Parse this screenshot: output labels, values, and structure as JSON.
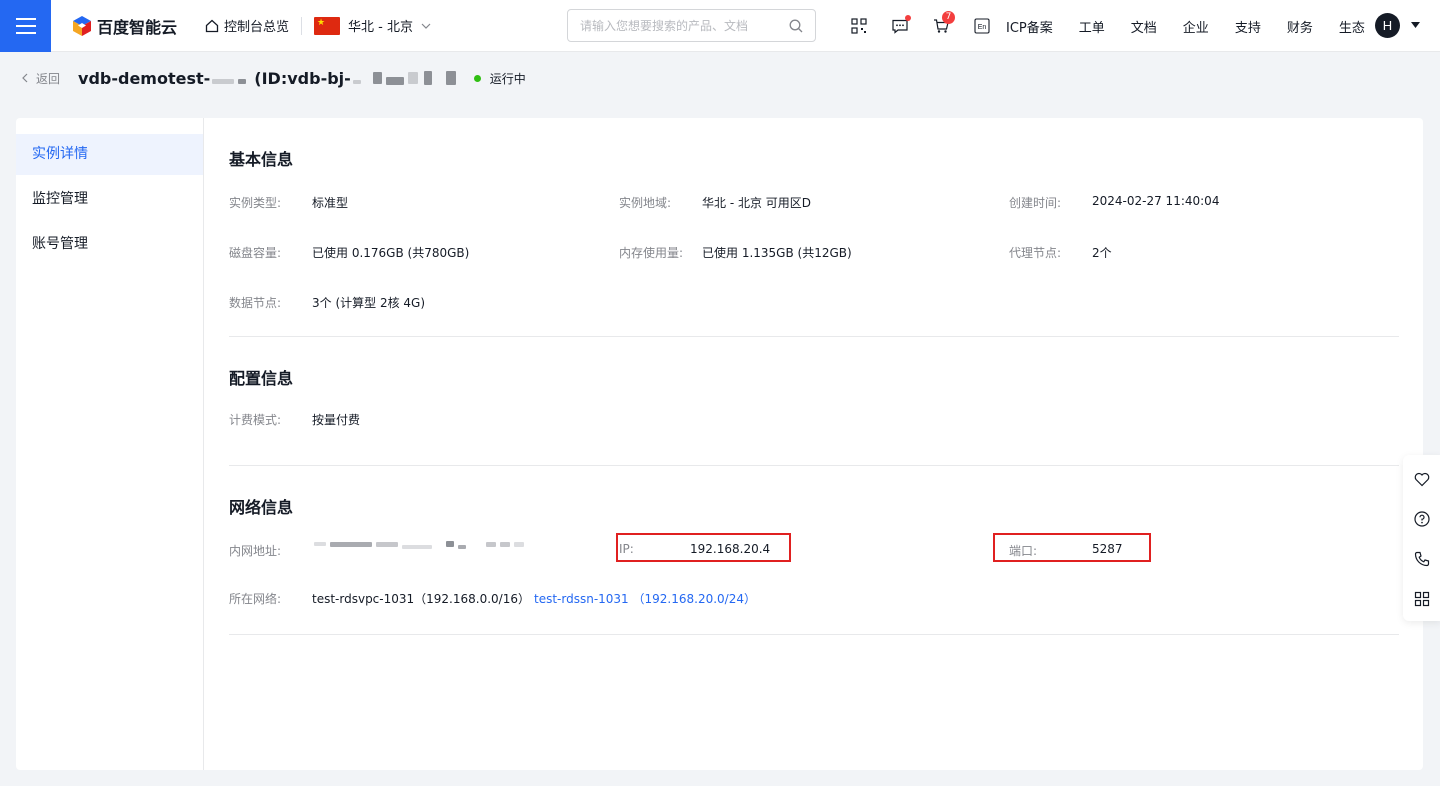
{
  "header": {
    "brand": "百度智能云",
    "console_home": "控制台总览",
    "region": "华北 - 北京",
    "search_placeholder": "请输入您想要搜索的产品、文档",
    "cart_badge": "7",
    "links": [
      "ICP备案",
      "工单",
      "文档",
      "企业",
      "支持",
      "财务",
      "生态"
    ],
    "avatar_initial": "H",
    "lang_icon_text": "En"
  },
  "subheader": {
    "back_label": "返回",
    "title_prefix": "vdb-demotest-",
    "id_prefix": "(ID:vdb-bj-",
    "status": "运行中"
  },
  "sidebar": {
    "items": [
      {
        "label": "实例详情",
        "active": true
      },
      {
        "label": "监控管理",
        "active": false
      },
      {
        "label": "账号管理",
        "active": false
      }
    ]
  },
  "basic_info": {
    "title": "基本信息",
    "fields": [
      {
        "label": "实例类型:",
        "value": "标准型"
      },
      {
        "label": "实例地域:",
        "value": "华北 - 北京 可用区D"
      },
      {
        "label": "创建时间:",
        "value": "2024-02-27 11:40:04"
      },
      {
        "label": "磁盘容量:",
        "value": "已使用 0.176GB (共780GB)"
      },
      {
        "label": "内存使用量:",
        "value": "已使用 1.135GB (共12GB)"
      },
      {
        "label": "代理节点:",
        "value": "2个"
      },
      {
        "label": "数据节点:",
        "value": "3个 (计算型 2核 4G)"
      }
    ]
  },
  "config_info": {
    "title": "配置信息",
    "fields": [
      {
        "label": "计费模式:",
        "value": "按量付费"
      }
    ]
  },
  "network_info": {
    "title": "网络信息",
    "internal_address_label": "内网地址:",
    "ip_label": "IP:",
    "ip_value": "192.168.20.4",
    "port_label": "端口:",
    "port_value": "5287",
    "network_label": "所在网络:",
    "vpc_text": "test-rdsvpc-1031（192.168.0.0/16）",
    "subnet_link": "test-rdssn-1031 （192.168.20.0/24）"
  },
  "colors": {
    "primary": "#2468f2",
    "status_running": "#30bf13",
    "highlight_box": "#e02020"
  }
}
